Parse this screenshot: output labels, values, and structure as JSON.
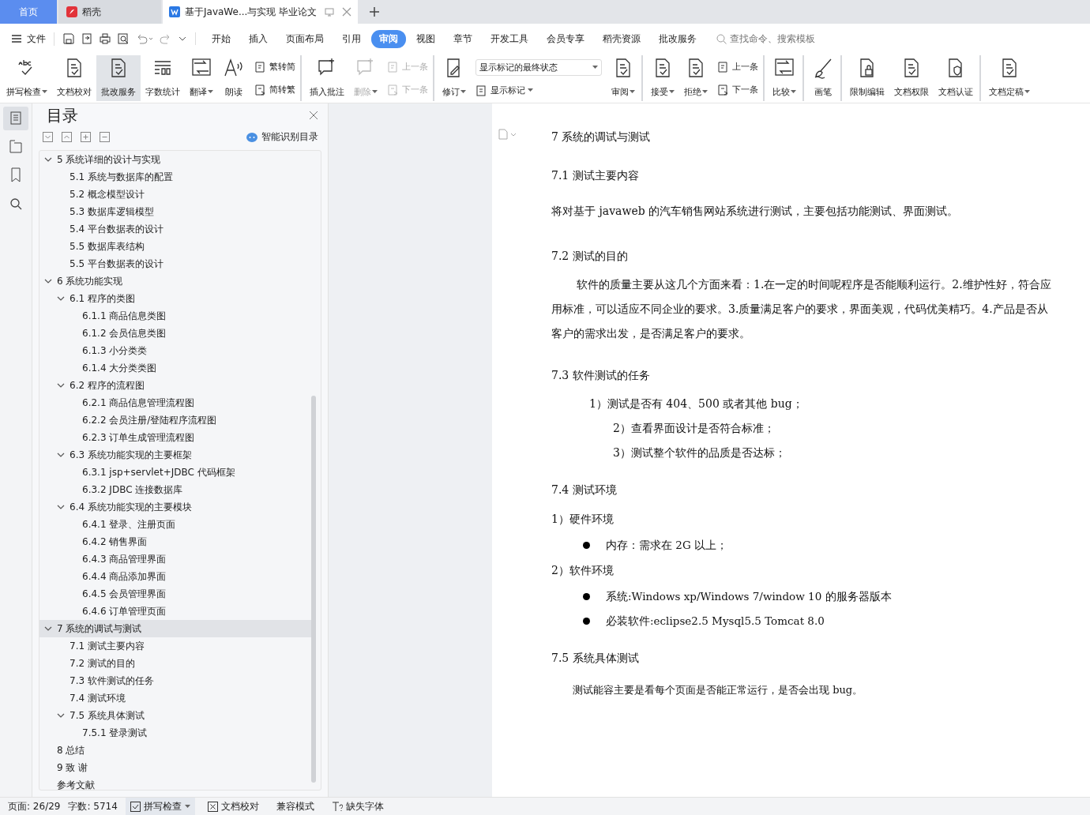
{
  "tabs": [
    {
      "label": "首页",
      "kind": "home",
      "selected": false
    },
    {
      "label": "稻壳",
      "kind": "app",
      "selected": false
    },
    {
      "label": "基于JavaWe...与实现 毕业论文",
      "kind": "doc",
      "selected": true
    }
  ],
  "menu": {
    "file": "文件",
    "items": [
      {
        "label": "开始",
        "selected": false
      },
      {
        "label": "插入",
        "selected": false
      },
      {
        "label": "页面布局",
        "selected": false
      },
      {
        "label": "引用",
        "selected": false
      },
      {
        "label": "审阅",
        "selected": true
      },
      {
        "label": "视图",
        "selected": false
      },
      {
        "label": "章节",
        "selected": false
      },
      {
        "label": "开发工具",
        "selected": false
      },
      {
        "label": "会员专享",
        "selected": false
      },
      {
        "label": "稻壳资源",
        "selected": false
      },
      {
        "label": "批改服务",
        "selected": false
      }
    ],
    "search": {
      "placeholder": "查找命令、搜索模板"
    }
  },
  "ribbon": [
    {
      "kind": "large",
      "label": "拼写检查",
      "dropdown": true,
      "selected": false,
      "disabled": false
    },
    {
      "kind": "large",
      "label": "文档校对",
      "dropdown": false,
      "selected": false,
      "disabled": false
    },
    {
      "kind": "large",
      "label": "批改服务",
      "dropdown": false,
      "selected": true,
      "disabled": false
    },
    {
      "kind": "large",
      "label": "字数统计",
      "dropdown": false,
      "selected": false,
      "disabled": false
    },
    {
      "kind": "large",
      "label": "翻译",
      "dropdown": true,
      "selected": false,
      "disabled": false
    },
    {
      "kind": "large",
      "label": "朗读",
      "dropdown": false,
      "selected": false,
      "disabled": false
    },
    {
      "kind": "pair",
      "top": "繁转简",
      "bottom": "简转繁",
      "disabled": false,
      "separator": true
    },
    {
      "kind": "large",
      "label": "插入批注",
      "dropdown": false,
      "selected": false,
      "disabled": false
    },
    {
      "kind": "large",
      "label": "删除",
      "dropdown": true,
      "selected": false,
      "disabled": true
    },
    {
      "kind": "pair",
      "top": "上一条",
      "bottom": "下一条",
      "disabled": true,
      "separator": true
    },
    {
      "kind": "large",
      "label": "修订",
      "dropdown": true,
      "selected": false,
      "disabled": false
    },
    {
      "kind": "select",
      "value": "显示标记的最终状态",
      "label": "显示标记"
    },
    {
      "kind": "large",
      "label": "审阅",
      "dropdown": true,
      "selected": false,
      "disabled": false,
      "separator": true
    },
    {
      "kind": "large",
      "label": "接受",
      "dropdown": true,
      "selected": false,
      "disabled": false
    },
    {
      "kind": "large",
      "label": "拒绝",
      "dropdown": true,
      "selected": false,
      "disabled": false
    },
    {
      "kind": "pair",
      "top": "上一条",
      "bottom": "下一条",
      "disabled": false,
      "separator": true
    },
    {
      "kind": "large",
      "label": "比较",
      "dropdown": true,
      "selected": false,
      "disabled": false,
      "separator": true
    },
    {
      "kind": "large",
      "label": "画笔",
      "dropdown": false,
      "selected": false,
      "disabled": false,
      "separator": true
    },
    {
      "kind": "large",
      "label": "限制编辑",
      "dropdown": false,
      "selected": false,
      "disabled": false
    },
    {
      "kind": "large",
      "label": "文档权限",
      "dropdown": false,
      "selected": false,
      "disabled": false
    },
    {
      "kind": "large",
      "label": "文档认证",
      "dropdown": false,
      "selected": false,
      "disabled": false,
      "separator": true
    },
    {
      "kind": "large",
      "label": "文档定稿",
      "dropdown": true,
      "selected": false,
      "disabled": false
    }
  ],
  "sidebar": {
    "title": "目录",
    "smart_toc": "智能识别目录",
    "items": [
      {
        "label": "5  系统详细的设计与实现",
        "selected": false,
        "expanded": true,
        "children": [
          {
            "label": "5.1 系统与数据库的配置",
            "selected": false
          },
          {
            "label": "5.2 概念模型设计",
            "selected": false
          },
          {
            "label": "5.3 数据库逻辑模型",
            "selected": false
          },
          {
            "label": "5.4 平台数据表的设计",
            "selected": false
          },
          {
            "label": "5.5 数据库表结构",
            "selected": false
          },
          {
            "label": "5.5 平台数据表的设计",
            "selected": false
          }
        ]
      },
      {
        "label": "6  系统功能实现",
        "selected": false,
        "expanded": true,
        "children": [
          {
            "label": "6.1 程序的类图",
            "selected": false,
            "expanded": true,
            "children": [
              {
                "label": "6.1.1 商品信息类图",
                "selected": false
              },
              {
                "label": "6.1.2 会员信息类图",
                "selected": false
              },
              {
                "label": "6.1.3 小分类类",
                "selected": false
              },
              {
                "label": "6.1.4 大分类类图",
                "selected": false
              }
            ]
          },
          {
            "label": "6.2 程序的流程图",
            "selected": false,
            "expanded": true,
            "children": [
              {
                "label": "6.2.1 商品信息管理流程图",
                "selected": false
              },
              {
                "label": "6.2.2 会员注册/登陆程序流程图",
                "selected": false
              },
              {
                "label": "6.2.3 订单生成管理流程图",
                "selected": false
              }
            ]
          },
          {
            "label": "6.3 系统功能实现的主要框架",
            "selected": false,
            "expanded": true,
            "children": [
              {
                "label": "6.3.1    jsp+servlet+JDBC 代码框架",
                "selected": false
              },
              {
                "label": "6.3.2 JDBC 连接数据库",
                "selected": false
              }
            ]
          },
          {
            "label": "6.4 系统功能实现的主要模块",
            "selected": false,
            "expanded": true,
            "children": [
              {
                "label": "6.4.1  登录、注册页面",
                "selected": false
              },
              {
                "label": "6.4.2  销售界面",
                "selected": false
              },
              {
                "label": "6.4.3  商品管理界面",
                "selected": false
              },
              {
                "label": "6.4.4  商品添加界面",
                "selected": false
              },
              {
                "label": "6.4.5  会员管理界面",
                "selected": false
              },
              {
                "label": "6.4.6  订单管理页面",
                "selected": false
              }
            ]
          }
        ]
      },
      {
        "label": "7  系统的调试与测试",
        "selected": true,
        "expanded": true,
        "children": [
          {
            "label": "7.1 测试主要内容",
            "selected": false
          },
          {
            "label": "7.2 测试的目的",
            "selected": false
          },
          {
            "label": "7.3 软件测试的任务",
            "selected": false
          },
          {
            "label": "7.4  测试环境",
            "selected": false
          },
          {
            "label": "7.5    系统具体测试",
            "selected": false,
            "expanded": true,
            "children": [
              {
                "label": "7.5.1  登录测试",
                "selected": false
              }
            ]
          }
        ]
      },
      {
        "label": "8  总结",
        "selected": false
      },
      {
        "label": "9  致  谢",
        "selected": false
      },
      {
        "label": "参考文献",
        "selected": false
      }
    ]
  },
  "document": [
    {
      "kind": "title",
      "text": "7  系统的调试与测试"
    },
    {
      "kind": "heading",
      "text": "7.1 测试主要内容"
    },
    {
      "kind": "paragraph",
      "text": "将对基于 javaweb 的汽车销售网站系统进行测试，主要包括功能测试、界面测试。"
    },
    {
      "kind": "heading",
      "text": "7.2 测试的目的"
    },
    {
      "kind": "indented",
      "text": "软件的质量主要从这几个方面来看：1.在一定的时间呢程序是否能顺利运行。2.维护性好，符合应用标准，可以适应不同企业的要求。3.质量满足客户的要求，界面美观，代码优美精巧。4.产品是否从客户的需求出发，是否满足客户的要求。"
    },
    {
      "kind": "heading",
      "text": "7.3 软件测试的任务"
    },
    {
      "kind": "list-item",
      "text": "1）测试是否有 404、500 或者其他 bug；"
    },
    {
      "kind": "list-item",
      "text": "2）查看界面设计是否符合标准；"
    },
    {
      "kind": "list-item",
      "text": "3）测试整个软件的品质是否达标；"
    },
    {
      "kind": "heading",
      "text": "7.4  测试环境"
    },
    {
      "kind": "subheading",
      "text": "1）硬件环境"
    },
    {
      "kind": "bullet",
      "text": "内存：需求在 2G 以上；"
    },
    {
      "kind": "subheading",
      "text": "2）软件环境"
    },
    {
      "kind": "bullet",
      "text": "系统:Windows xp/Windows 7/window 10 的服务器版本"
    },
    {
      "kind": "bullet",
      "text": "必装软件:eclipse2.5   Mysql5.5 Tomcat 8.0"
    },
    {
      "kind": "heading",
      "text": "7.5   系统具体测试"
    },
    {
      "kind": "paragraph-small",
      "text": "测试能容主要是看每个页面是否能正常运行，是否会出现 bug。"
    }
  ],
  "status_bar": {
    "page": "页面: 26/29",
    "words": "字数: 5714",
    "spell": "拼写检查",
    "proof": "文档校对",
    "compat": "兼容模式",
    "fonts": "缺失字体"
  }
}
